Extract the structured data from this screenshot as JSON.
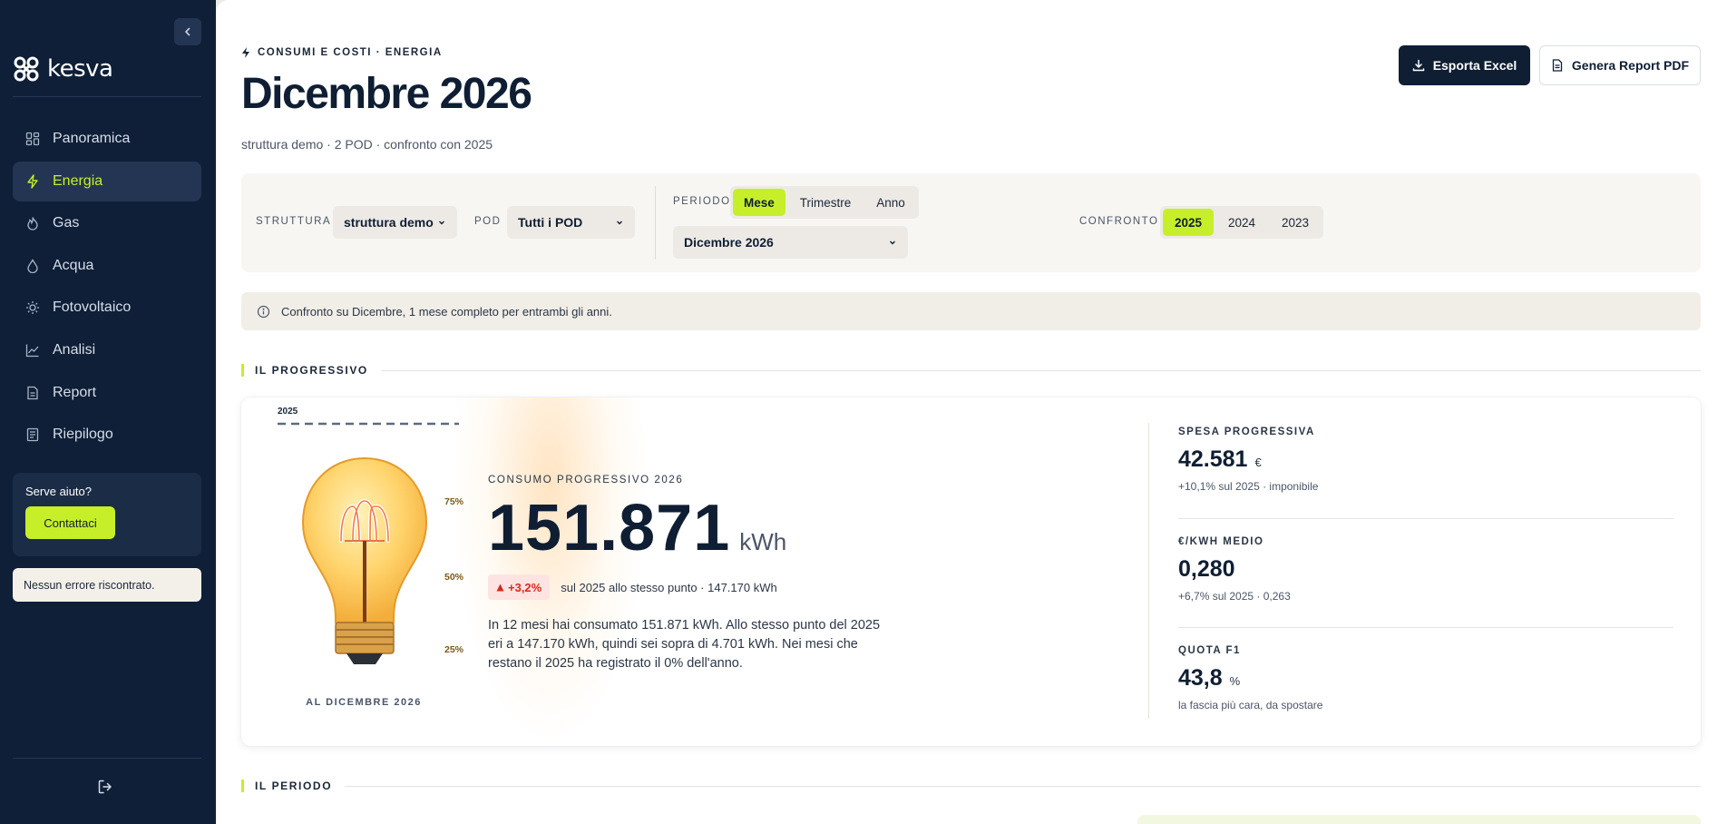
{
  "sidebar": {
    "logo_text": "kesva",
    "items": [
      {
        "label": "Panoramica",
        "icon": "grid-icon"
      },
      {
        "label": "Energia",
        "icon": "bolt-icon"
      },
      {
        "label": "Gas",
        "icon": "flame-icon"
      },
      {
        "label": "Acqua",
        "icon": "drop-icon"
      },
      {
        "label": "Fotovoltaico",
        "icon": "sun-icon"
      },
      {
        "label": "Analisi",
        "icon": "chart-icon"
      },
      {
        "label": "Report",
        "icon": "document-icon"
      },
      {
        "label": "Riepilogo",
        "icon": "list-icon"
      }
    ],
    "active_item": "Energia",
    "help_title": "Serve aiuto?",
    "help_button": "Contattaci",
    "status_message": "Nessun errore riscontrato."
  },
  "header": {
    "eyebrow": "CONSUMI E COSTI · ENERGIA",
    "title": "Dicembre 2026",
    "subtitle": "struttura demo · 2 POD · confronto con 2025",
    "export_excel": "Esporta Excel",
    "pdf_report": "Genera Report PDF"
  },
  "filters": {
    "struttura_label": "STRUTTURA",
    "struttura_value": "struttura demo",
    "pod_label": "POD",
    "pod_value": "Tutti i POD",
    "periodo_label": "PERIODO",
    "periodo_options": [
      "Mese",
      "Trimestre",
      "Anno"
    ],
    "periodo_selected": "Mese",
    "period_value": "Dicembre 2026",
    "confronto_label": "CONFRONTO",
    "confronto_options": [
      "2025",
      "2024",
      "2023"
    ],
    "confronto_selected": "2025"
  },
  "info_message": "Confronto su Dicembre, 1 mese completo per entrambi gli anni.",
  "sections": {
    "progressivo": "IL PROGRESSIVO",
    "periodo": "IL PERIODO"
  },
  "progress": {
    "legend_year": "2025",
    "markers": [
      "75%",
      "50%",
      "25%"
    ],
    "bulb_caption": "AL DICEMBRE 2026",
    "consumption_label": "CONSUMO PROGRESSIVO 2026",
    "consumption_value": "151.871",
    "consumption_unit": "kWh",
    "delta": "+3,2%",
    "delta_text": "sul 2025 allo stesso punto · 147.170 kWh",
    "description": "In 12 mesi hai consumato 151.871 kWh. Allo stesso punto del 2025 eri a 147.170 kWh, quindi sei sopra di 4.701 kWh. Nei mesi che restano il 2025 ha registrato il 0% dell'anno.",
    "fill_level": 1.0
  },
  "kpis": [
    {
      "label": "SPESA PROGRESSIVA",
      "value": "42.581",
      "unit": "€",
      "sub": "+10,1% sul 2025 · imponibile"
    },
    {
      "label": "€/KWH MEDIO",
      "value": "0,280",
      "unit": "",
      "sub": "+6,7% sul 2025 · 0,263"
    },
    {
      "label": "QUOTA F1",
      "value": "43,8",
      "unit": "%",
      "sub": "la fascia più cara, da spostare"
    }
  ],
  "colors": {
    "accent": "#c6ef2a",
    "sidebar_bg": "#0f1f38",
    "negative": "#d62a1f"
  }
}
